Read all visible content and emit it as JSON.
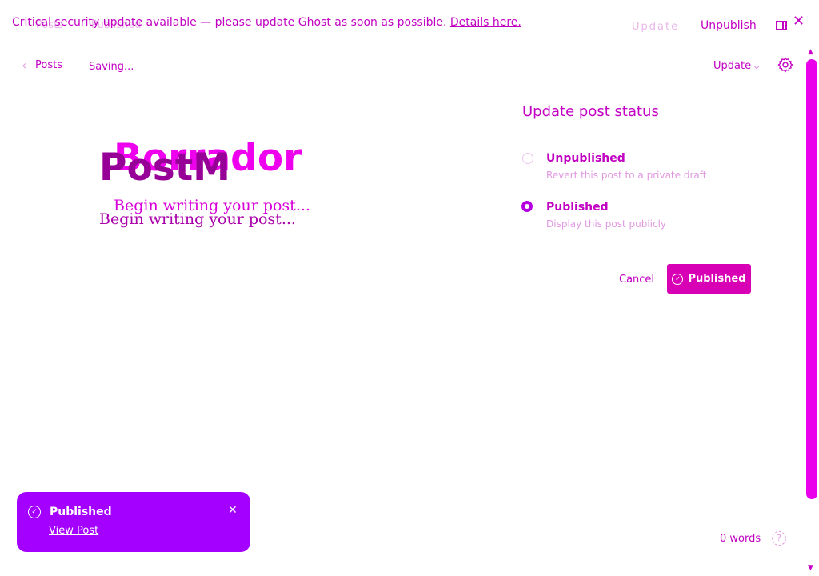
{
  "banner": {
    "message": "Critical security update available — please update Ghost as soon as possible.",
    "link": "Details here."
  },
  "background_header": {
    "posts": "Posts",
    "status": "Published",
    "update": "Update"
  },
  "header": {
    "unpublish": "Unpublish"
  },
  "toolbar": {
    "back_label": "Posts",
    "saving": "Saving...",
    "update_label": "Update"
  },
  "editor": {
    "title_overlay": "Borrador",
    "title": "PostM",
    "placeholder_overlay": "Begin writing your post...",
    "placeholder": "Begin writing your post..."
  },
  "status_panel": {
    "title": "Update post status",
    "options": [
      {
        "label": "Unpublished",
        "description": "Revert this post to a private draft",
        "selected": false
      },
      {
        "label": "Published",
        "description": "Display this post publicly",
        "selected": true
      }
    ],
    "cancel": "Cancel",
    "confirm": "Published"
  },
  "toast": {
    "title": "Published",
    "link": "View Post"
  },
  "footer": {
    "word_count": "0 words"
  },
  "colors": {
    "accent": "#c800c8",
    "button": "#d800b4",
    "toast": "#a400ff",
    "scrollbar": "#ea00ea"
  },
  "icons": [
    "chevron-left-icon",
    "chevron-down-icon",
    "gear-icon",
    "sidebar-panel-icon",
    "close-icon",
    "check-circle-icon",
    "help-icon"
  ]
}
